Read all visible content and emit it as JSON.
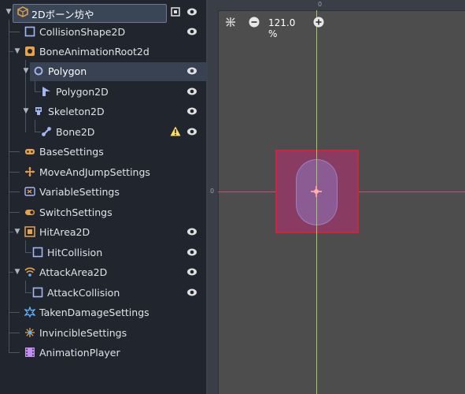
{
  "tree": {
    "items": [
      {
        "label": "2Dボーン坊や"
      },
      {
        "label": "CollisionShape2D"
      },
      {
        "label": "BoneAnimationRoot2d"
      },
      {
        "label": "Polygon"
      },
      {
        "label": "Polygon2D"
      },
      {
        "label": "Skeleton2D"
      },
      {
        "label": "Bone2D"
      },
      {
        "label": "BaseSettings"
      },
      {
        "label": "MoveAndJumpSettings"
      },
      {
        "label": "VariableSettings"
      },
      {
        "label": "SwitchSettings"
      },
      {
        "label": "HitArea2D"
      },
      {
        "label": "HitCollision"
      },
      {
        "label": "AttackArea2D"
      },
      {
        "label": "AttackCollision"
      },
      {
        "label": "TakenDamageSettings"
      },
      {
        "label": "InvincibleSettings"
      },
      {
        "label": "AnimationPlayer"
      }
    ]
  },
  "viewport": {
    "zoom": "121.0 %",
    "ruler_top_label": "0",
    "ruler_left_label": "0"
  },
  "colors": {
    "panel_bg": "#21262e",
    "viewport_bg": "#4d4d4d",
    "y_axis": "#9dce58",
    "x_axis": "#c84a82",
    "collision_fill": "#8a3b62",
    "collision_border": "#c8283c"
  }
}
